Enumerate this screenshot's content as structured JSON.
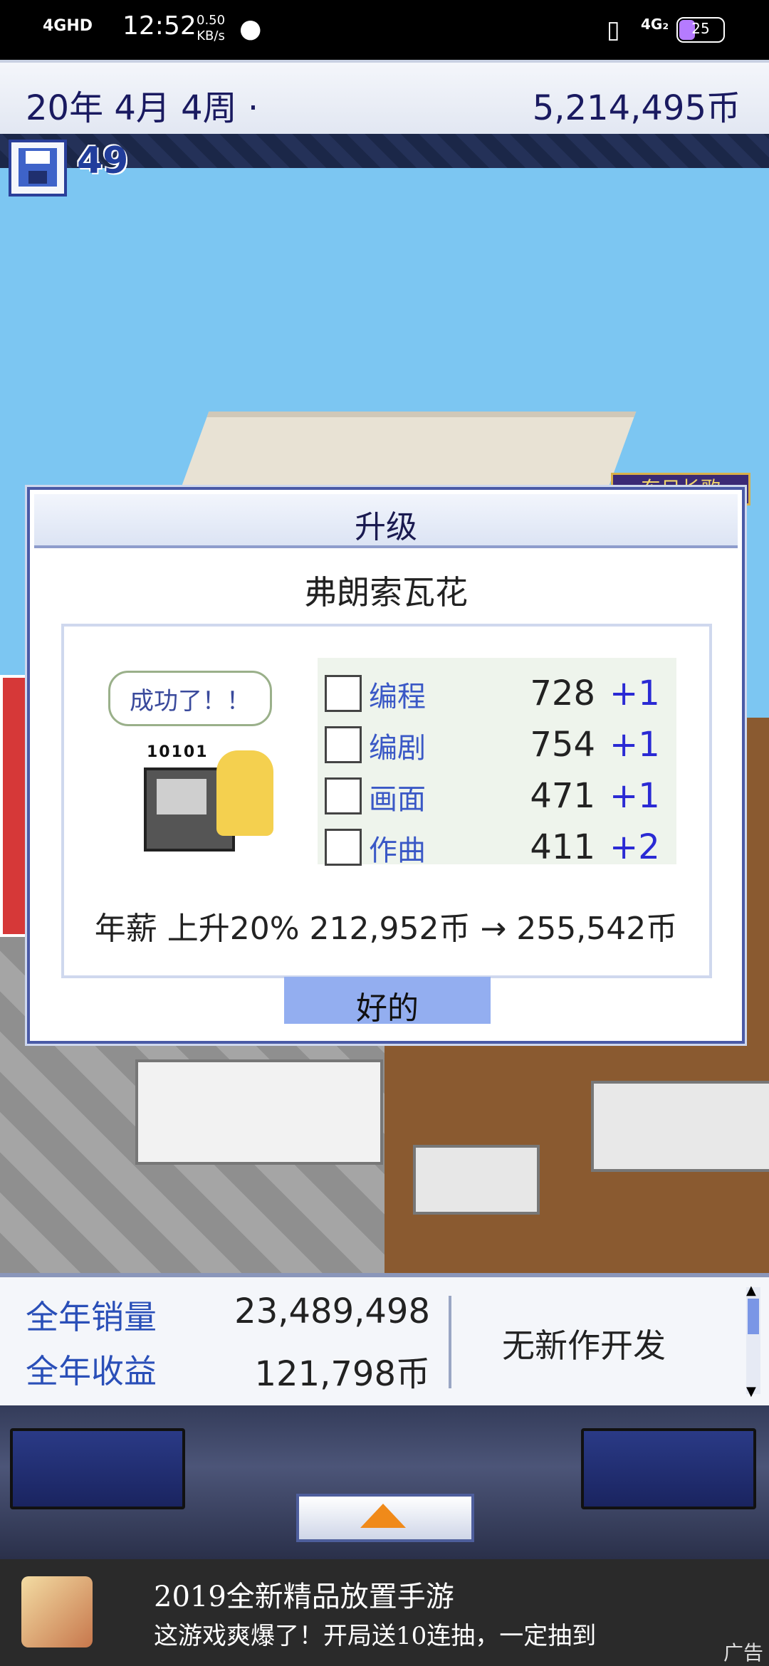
{
  "status_bar": {
    "signal": "4GHD",
    "time": "12:52",
    "speed_value": "0.50",
    "speed_unit": "KB/s",
    "network": "4G₂",
    "battery": "25"
  },
  "top_bar": {
    "date": "20年 4月 4周 ·",
    "money": "5,214,495币"
  },
  "save": {
    "count": "49"
  },
  "scene": {
    "banner": "东日长歌"
  },
  "dialog": {
    "title": "升级",
    "name": "弗朗索瓦花",
    "bubble": "成功了！！",
    "bits": "10101",
    "stats": [
      {
        "label": "编程",
        "value": "728",
        "delta": "+1"
      },
      {
        "label": "编剧",
        "value": "754",
        "delta": "+1"
      },
      {
        "label": "画面",
        "value": "471",
        "delta": "+1"
      },
      {
        "label": "作曲",
        "value": "411",
        "delta": "+2"
      }
    ],
    "salary": "年薪 上升20% 212,952币 → 255,542币",
    "ok": "好的"
  },
  "bottom_panel": {
    "sales_label": "全年销量",
    "sales_value": "23,489,498",
    "revenue_label": "全年收益",
    "revenue_value": "121,798币",
    "status": "无新作开发"
  },
  "ad": {
    "title": "2019全新精品放置手游",
    "subtitle": "这游戏爽爆了！开局送10连抽，一定抽到",
    "tag": "广告"
  }
}
